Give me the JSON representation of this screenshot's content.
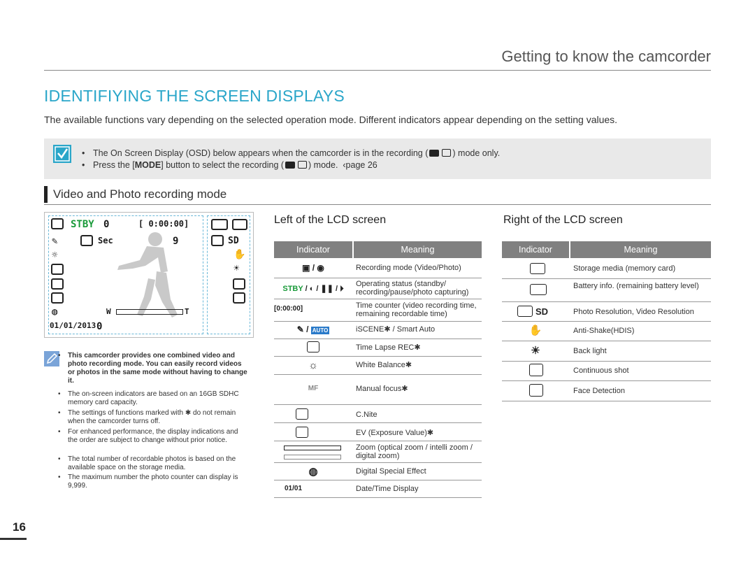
{
  "header": {
    "title": "Getting to know the camcorder"
  },
  "section": {
    "title": "IDENTIFIYING THE SCREEN DISPLAYS"
  },
  "intro": "The available functions vary depending on the selected operation mode. Different indicators appear depending on the setting values.",
  "note": {
    "icon": "note-check-icon",
    "line1_a": "The On Screen Display (OSD) below appears when the camcorder is in the recording (",
    "line1_b": ") mode only.",
    "line2_a": "Press the [",
    "line2_mode": "MODE",
    "line2_b": "] button to select the recording (",
    "line2_c": ") mode.",
    "line2_ref": "‹page 26"
  },
  "mode": {
    "title": "Video and Photo recording mode"
  },
  "lcd": {
    "stby": "STBY",
    "zero1": "0",
    "time": "[ 0:00:00]",
    "sec": "Sec",
    "nine": "9",
    "w": "W",
    "t": "T",
    "date": "01/01/2013",
    "zero2": "0",
    "sd": "SD"
  },
  "side_notes": [
    {
      "text": "This camcorder provides one combined video and photo recording mode. You can easily record videos or photos in the same mode without having to change it.",
      "bold": true
    },
    {
      "text": "The on-screen indicators are based on an 16GB SDHC memory card capacity.",
      "bold": false
    },
    {
      "text": "The settings of functions marked with ✱ do not remain when the camcorder turns off.",
      "bold": false
    },
    {
      "text": "For enhanced performance, the display indications and the order are subject to change without prior notice.",
      "bold": false
    },
    {
      "text": "The total number of recordable photos is based on the available space on the storage media.",
      "bold": false
    },
    {
      "text": "The maximum number the photo counter can display is 9,999.",
      "bold": false
    }
  ],
  "left_table": {
    "title": "Left of the LCD screen",
    "header": {
      "indicator": "Indicator",
      "meaning": "Meaning"
    },
    "rows": [
      {
        "icon": "video-photo-mode-icon",
        "meaning": "Recording mode (Video/Photo)"
      },
      {
        "icon": "operating-status-icon",
        "icon_text": "STBY",
        "meaning": "Operating status (standby/ recording/pause/photo capturing)"
      },
      {
        "icon": "time-counter-icon",
        "icon_text": "[0:00:00]",
        "meaning": "Time counter (video recording time, remaining recordable time)"
      },
      {
        "icon": "iscene-smart-auto-icon",
        "meaning": "iSCENE✱ / Smart Auto"
      },
      {
        "icon": "time-lapse-icon",
        "meaning": "Time Lapse REC✱"
      },
      {
        "icon": "white-balance-icon",
        "meaning": "White Balance✱"
      },
      {
        "icon": "manual-focus-icon",
        "icon_text": "MF",
        "meaning": "Manual focus✱"
      },
      {
        "icon": "cnite-icon",
        "meaning": "C.Nite"
      },
      {
        "icon": "ev-icon",
        "meaning": "EV (Exposure Value)✱"
      },
      {
        "icon": "zoom-bar-icon",
        "meaning": "Zoom (optical zoom / intelli zoom / digital zoom)"
      },
      {
        "icon": "digital-effect-icon",
        "meaning": "Digital Special Effect"
      },
      {
        "icon": "date-time-icon",
        "icon_text": "01/01",
        "meaning": "Date/Time Display"
      }
    ]
  },
  "right_table": {
    "title": "Right of the LCD screen",
    "header": {
      "indicator": "Indicator",
      "meaning": "Meaning"
    },
    "rows": [
      {
        "icon": "storage-media-icon",
        "meaning": "Storage media (memory card)"
      },
      {
        "icon": "battery-icon",
        "meaning": "Battery info. (remaining battery level)"
      },
      {
        "icon": "photo-resolution-icon",
        "icon_text": "SD",
        "meaning": "Photo Resolution, Video Resolution"
      },
      {
        "icon": "anti-shake-icon",
        "meaning": "Anti-Shake(HDIS)"
      },
      {
        "icon": "back-light-icon",
        "meaning": "Back light"
      },
      {
        "icon": "continuous-shot-icon",
        "meaning": "Continuous shot"
      },
      {
        "icon": "face-detection-icon",
        "meaning": "Face Detection"
      }
    ]
  },
  "page": {
    "number": "16"
  }
}
